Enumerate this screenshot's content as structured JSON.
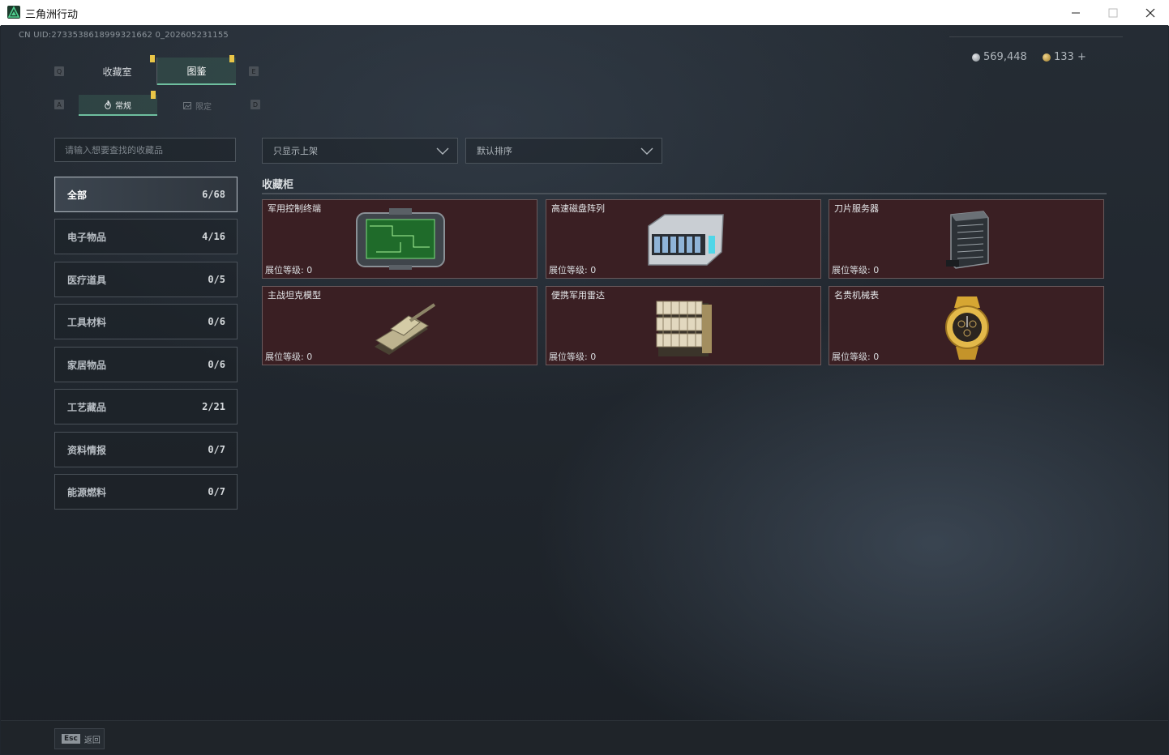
{
  "window": {
    "title": "三角洲行动"
  },
  "header": {
    "uid": "CN UID:2733538618999321662 0_202605231155",
    "silver": "569,448",
    "gold": "133 +"
  },
  "tabs": {
    "left_key": "Q",
    "right_key": "E",
    "collection": "收藏室",
    "codex": "图鉴"
  },
  "subtabs": {
    "left_key": "A",
    "right_key": "D",
    "normal": "常规",
    "limited": "限定"
  },
  "search": {
    "placeholder": "请输入想要查找的收藏品"
  },
  "filters": {
    "shelf": "只显示上架",
    "sort": "默认排序"
  },
  "categories": [
    {
      "label": "全部",
      "count": "6/68"
    },
    {
      "label": "电子物品",
      "count": "4/16"
    },
    {
      "label": "医疗道具",
      "count": "0/5"
    },
    {
      "label": "工具材料",
      "count": "0/6"
    },
    {
      "label": "家居物品",
      "count": "0/6"
    },
    {
      "label": "工艺藏品",
      "count": "2/21"
    },
    {
      "label": "资料情报",
      "count": "0/7"
    },
    {
      "label": "能源燃料",
      "count": "0/7"
    }
  ],
  "cabinet": {
    "title": "收藏柜",
    "items": [
      {
        "name": "军用控制终端",
        "level": "展位等级: 0",
        "icon": "control-terminal"
      },
      {
        "name": "高速磁盘阵列",
        "level": "展位等级: 0",
        "icon": "disk-array"
      },
      {
        "name": "刀片服务器",
        "level": "展位等级: 0",
        "icon": "blade-server"
      },
      {
        "name": "主战坦克模型",
        "level": "展位等级: 0",
        "icon": "tank-model"
      },
      {
        "name": "便携军用雷达",
        "level": "展位等级: 0",
        "icon": "portable-radar"
      },
      {
        "name": "名贵机械表",
        "level": "展位等级: 0",
        "icon": "luxury-watch"
      }
    ]
  },
  "footer": {
    "esc_key": "Esc",
    "back_label": "返回"
  },
  "colors": {
    "accent": "#6fbf9f",
    "marker": "#e9c547",
    "card_bg": "#3a1f23"
  }
}
